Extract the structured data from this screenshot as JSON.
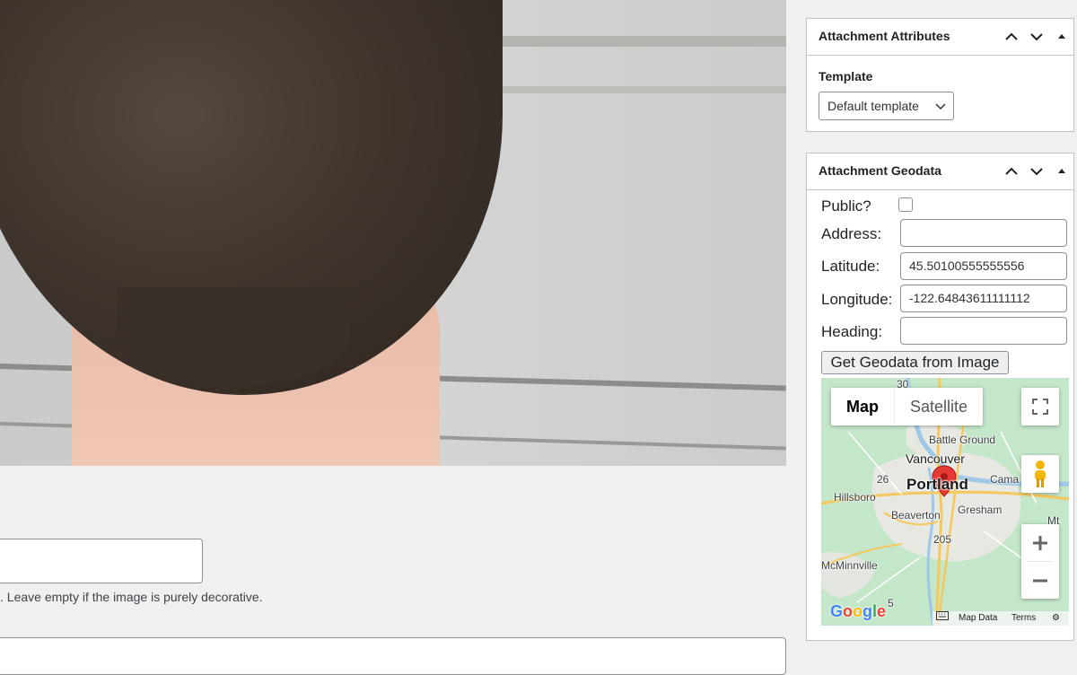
{
  "alt_text": {
    "help_text": ". Leave empty if the image is purely decorative.",
    "value": ""
  },
  "attachment_attributes": {
    "title": "Attachment Attributes",
    "template_label": "Template",
    "template_selected": "Default template"
  },
  "attachment_geodata": {
    "title": "Attachment Geodata",
    "public_label": "Public?",
    "public_checked": false,
    "address_label": "Address:",
    "address_value": "",
    "latitude_label": "Latitude:",
    "latitude_value": "45.50100555555556",
    "longitude_label": "Longitude:",
    "longitude_value": "-122.64843611111112",
    "heading_label": "Heading:",
    "heading_value": "",
    "get_geodata_button": "Get Geodata from Image"
  },
  "map": {
    "type_map": "Map",
    "type_satellite": "Satellite",
    "labels": {
      "highway_30": "30",
      "battle_ground": "Battle Ground",
      "vancouver": "Vancouver",
      "portland": "Portland",
      "camas": "Cama",
      "hillsboro": "Hillsboro",
      "highway_26": "26",
      "beaverton": "Beaverton",
      "gresham": "Gresham",
      "mt": "Mt",
      "highway_205": "205",
      "mcminnville": "McMinnville",
      "highway_5": "5"
    },
    "logo": "Google",
    "footer_map_data": "Map Data",
    "footer_terms": "Terms",
    "colors": {
      "land": "#bfe3c7",
      "urban": "#e8e8e3",
      "water": "#9fc7e8",
      "road": "#f6c75a",
      "pin": "#e53935"
    }
  }
}
